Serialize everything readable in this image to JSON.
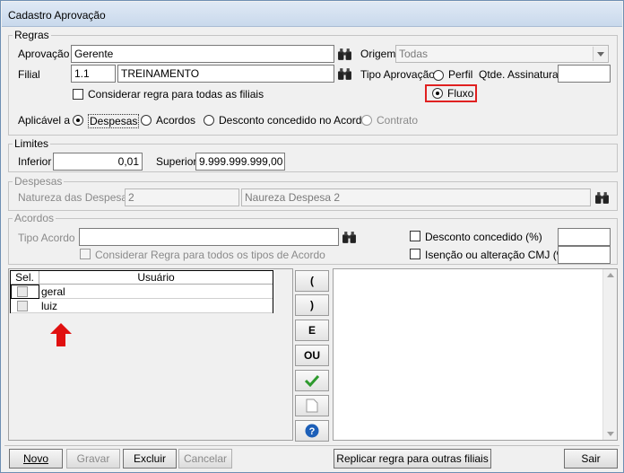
{
  "window": {
    "title": "Cadastro Aprovação"
  },
  "regras": {
    "legend": "Regras",
    "aprovacao_label": "Aprovação",
    "aprovacao_value": "Gerente",
    "origem_label": "Origem",
    "origem_value": "Todas",
    "filial_label": "Filial",
    "filial_code": "1.1",
    "filial_name": "TREINAMENTO",
    "tipo_aprovacao_label": "Tipo Aprovação",
    "perfil_label": "Perfil",
    "fluxo_label": "Fluxo",
    "qtde_label": "Qtde. Assinaturas",
    "qtde_value": "",
    "considerar_filiais_label": "Considerar regra para todas as filiais",
    "aplicavel_label": "Aplicável a",
    "despesas_label": "Despesas",
    "acordos_label": "Acordos",
    "desconto_label": "Desconto concedido no Acordo",
    "contrato_label": "Contrato"
  },
  "limites": {
    "legend": "Limites",
    "inferior_label": "Inferior",
    "inferior_value": "0,01",
    "superior_label": "Superior",
    "superior_value": "9.999.999.999,00"
  },
  "despesas": {
    "legend": "Despesas",
    "natureza_label": "Natureza das Despesas",
    "natureza_code": "2",
    "natureza_name": "Naureza Despesa 2"
  },
  "acordos": {
    "legend": "Acordos",
    "tipo_label": "Tipo Acordo",
    "tipo_value": "",
    "considerar_tipos_label": "Considerar Regra para todos os tipos de Acordo",
    "desconto_label": "Desconto concedido (%)",
    "isencao_label": "Isenção ou alteração CMJ (%)"
  },
  "grid": {
    "col_sel": "Sel.",
    "col_usuario": "Usuário",
    "rows": [
      {
        "usuario": "geral"
      },
      {
        "usuario": "luiz"
      }
    ]
  },
  "side_buttons": {
    "open_paren": "(",
    "close_paren": ")",
    "and": "E",
    "or": "OU"
  },
  "footer": {
    "novo": "Novo",
    "gravar": "Gravar",
    "excluir": "Excluir",
    "cancelar": "Cancelar",
    "replicar": "Replicar regra para outras filiais",
    "sair": "Sair"
  },
  "colors": {
    "highlight": "#e02020",
    "arrow": "#e01010",
    "check": "#2e9a2e",
    "help": "#1c5fb8"
  }
}
